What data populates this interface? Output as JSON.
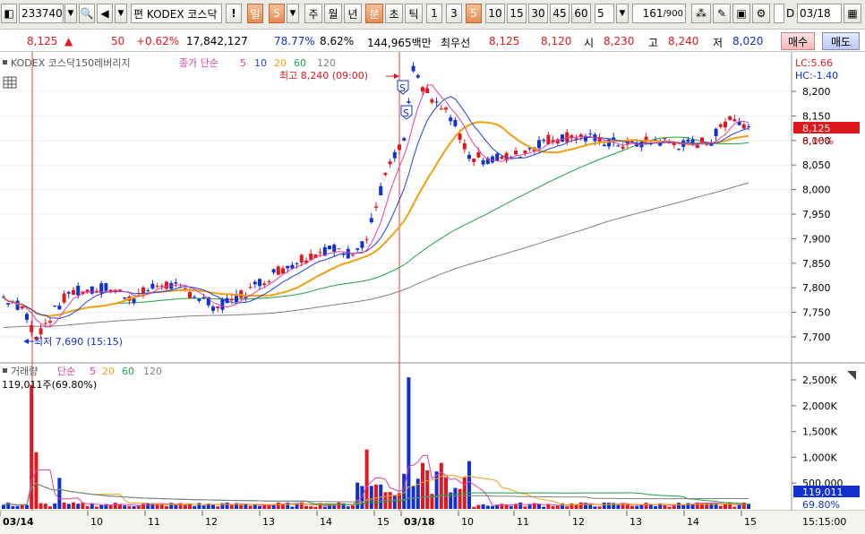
{
  "toolbar": {
    "code": "233740",
    "prefix": "편",
    "name": "KODEX 코스닥",
    "periods": [
      "일",
      "5"
    ],
    "periods2": [
      "주",
      "월",
      "년",
      "분",
      "초",
      "틱"
    ],
    "minutes": [
      "1",
      "3",
      "5",
      "10",
      "15",
      "30",
      "45",
      "60"
    ],
    "interval": "5",
    "count": "161",
    "count_total": "/900",
    "date": "03/18",
    "date_prefix": "D"
  },
  "quote": {
    "price": "8,125",
    "change": "50",
    "change_pct": "+0.62%",
    "volume": "17,842,127",
    "vol_ratio": "78.77%",
    "turnover": "8.62%",
    "amount": "144,965백만",
    "best_label": "최우선",
    "ask": "8,125",
    "bid": "8,120",
    "open_label": "시",
    "open": "8,230",
    "high_label": "고",
    "high": "8,240",
    "low_label": "저",
    "low": "8,020",
    "buy_label": "매수",
    "sell_label": "매도"
  },
  "price_panel": {
    "title": "KODEX 코스닥150레버리지",
    "ma_label": "종가 단순",
    "ma_periods": [
      "5",
      "10",
      "20",
      "60",
      "120"
    ],
    "lc": "LC:5.66",
    "hc": "HC:-1.40",
    "current": "8,125",
    "current_pct": "0.06%",
    "high_annot": "최고 8,240 (09:00)",
    "low_annot": "최저 7,690 (15:15)",
    "yticks": [
      "8,200",
      "8,150",
      "8,100",
      "8,050",
      "8,000",
      "7,950",
      "7,900",
      "7,850",
      "7,800",
      "7,750",
      "7,700"
    ],
    "marker": "S"
  },
  "volume_panel": {
    "title": "거래량",
    "ma_label": "단순",
    "ma_periods": [
      "5",
      "20",
      "60",
      "120"
    ],
    "last_vol": "119,011주(69.80%)",
    "yticks": [
      "2,500K",
      "2,000K",
      "1,500K",
      "1,000K",
      "500,000"
    ],
    "current": "119,011",
    "current_pct": "69.80%"
  },
  "time_axis": {
    "labels": [
      "03/14",
      "10",
      "11",
      "12",
      "13",
      "14",
      "15",
      "03/18",
      "10",
      "11",
      "12",
      "13",
      "14",
      "15"
    ],
    "last_time": "15:15:00"
  },
  "colors": {
    "up": "#e0181e",
    "down": "#1030d0",
    "ma5": "#e040a0",
    "ma10": "#2040e0",
    "ma20": "#f0a010",
    "ma60": "#20a040",
    "ma120": "#808080"
  }
}
